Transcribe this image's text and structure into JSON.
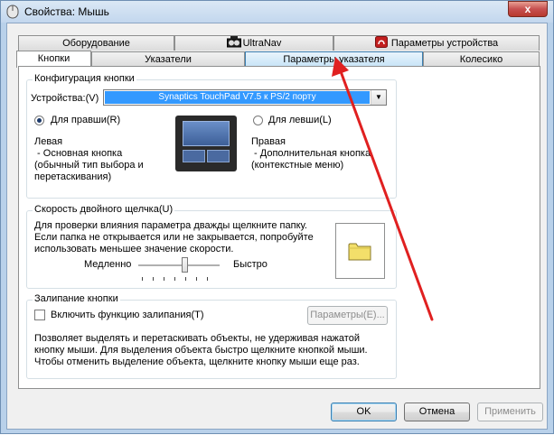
{
  "window": {
    "title": "Свойства: Мышь",
    "close_label": "x"
  },
  "tabs": {
    "row_back": [
      {
        "label": "Оборудование"
      },
      {
        "label": "UltraNav"
      },
      {
        "label": "Параметры устройства"
      }
    ],
    "row_front": [
      {
        "label": "Кнопки"
      },
      {
        "label": "Указатели"
      },
      {
        "label": "Параметры указателя"
      },
      {
        "label": "Колесико"
      }
    ],
    "active": "Кнопки"
  },
  "button_config": {
    "title": "Конфигурация кнопки",
    "device_label": "Устройства:(V)",
    "device_value": "Synaptics TouchPad V7.5 к PS/2 порту",
    "right_hand_label": "Для правши(R)",
    "left_hand_label": "Для левши(L)",
    "right_hand_selected": true,
    "left_desc": [
      "Левая",
      " - Основная кнопка",
      "(обычный тип выбора и",
      "перетаскивания)"
    ],
    "right_desc": [
      "Правая",
      " - Дополнительная кнопка",
      "(контекстные меню)"
    ]
  },
  "double_click": {
    "title": "Скорость двойного щелчка(U)",
    "desc": [
      "Для проверки влияния параметра дважды щелкните папку.",
      "Если папка не открывается или не закрывается, попробуйте",
      "использовать меньшее значение скорости."
    ],
    "slow_label": "Медленно",
    "fast_label": "Быстро",
    "speed_fraction": 0.57
  },
  "click_lock": {
    "title": "Залипание кнопки",
    "checkbox_label": "Включить функцию залипания(T)",
    "checked": false,
    "params_button": "Параметры(E)...",
    "desc": [
      "Позволяет выделять и перетаскивать объекты, не удерживая нажатой",
      "кнопку мыши. Для выделения объекта быстро щелкните кнопкой мыши.",
      "Чтобы отменить выделение объекта, щелкните кнопку мыши еще раз."
    ]
  },
  "footer": {
    "ok": "OK",
    "cancel": "Отмена",
    "apply": "Применить"
  },
  "colors": {
    "accent": "#3399ff",
    "arrow": "#e02020"
  },
  "icons": {
    "title": "mouse-icon",
    "ultranav": "ultranav-icon",
    "device": "device-settings-icon",
    "folder": "folder-icon"
  }
}
